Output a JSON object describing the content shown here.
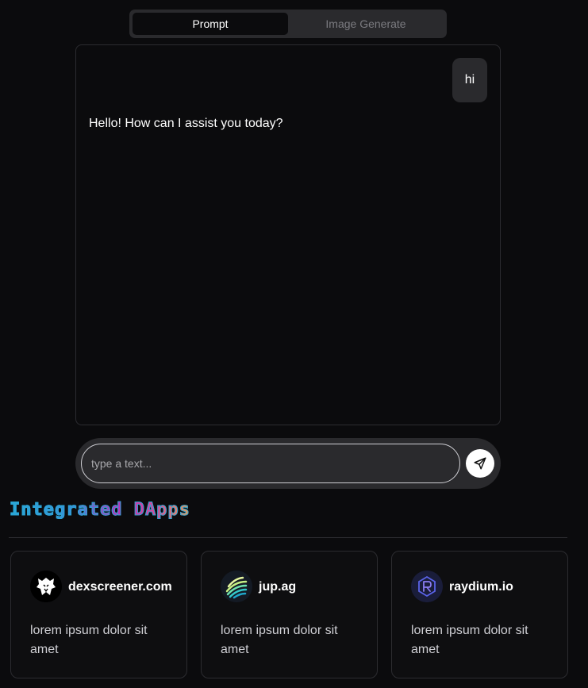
{
  "tabs": [
    {
      "label": "Prompt",
      "active": true
    },
    {
      "label": "Image Generate",
      "active": false
    }
  ],
  "chat": {
    "user_message": "hi",
    "bot_message": "Hello! How can I assist you today?"
  },
  "input": {
    "placeholder": "type a text...",
    "value": ""
  },
  "section": {
    "title": "Integrated DApps"
  },
  "dapps": [
    {
      "name": "dexscreener.com",
      "description": "lorem ipsum dolor sit amet",
      "icon": "eagle-icon"
    },
    {
      "name": "jup.ag",
      "description": "lorem ipsum dolor sit amet",
      "icon": "jupiter-icon"
    },
    {
      "name": "raydium.io",
      "description": "lorem ipsum dolor sit amet",
      "icon": "raydium-icon"
    }
  ],
  "colors": {
    "background": "#0b0b0d",
    "surface": "#2a2a2d",
    "border": "#2c2c30",
    "title_gradient_start": "#2aa7d6",
    "title_gradient_end": "#f0a050"
  }
}
